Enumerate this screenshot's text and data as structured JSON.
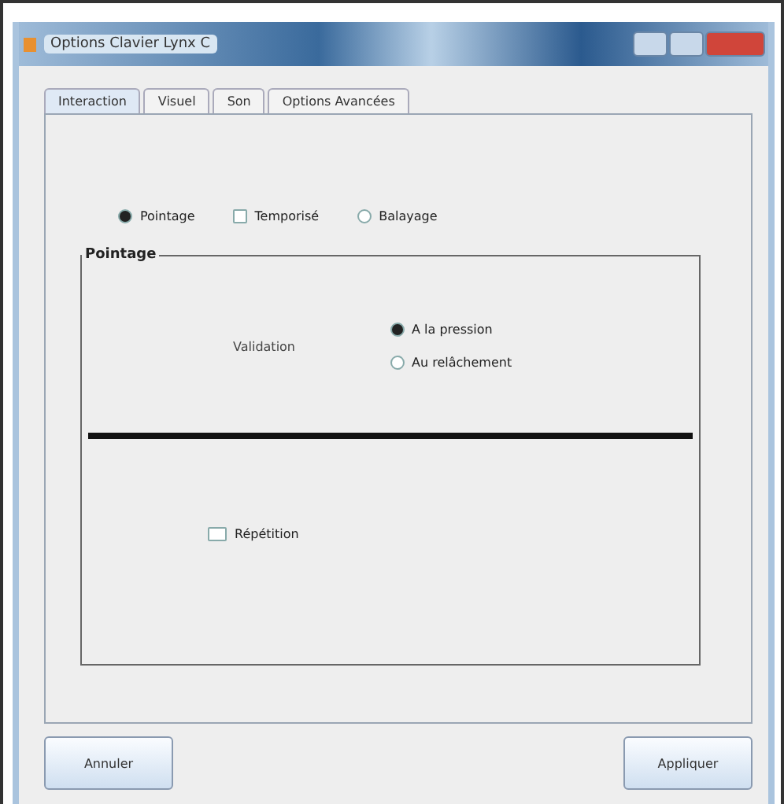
{
  "window": {
    "title": "Options Clavier Lynx C"
  },
  "tabs": [
    {
      "label": "Interaction",
      "selected": true
    },
    {
      "label": "Visuel",
      "selected": false
    },
    {
      "label": "Son",
      "selected": false
    },
    {
      "label": "Options Avancées",
      "selected": false
    }
  ],
  "modes": [
    {
      "label": "Pointage",
      "selected": true
    },
    {
      "label": "Temporisé",
      "selected": false
    },
    {
      "label": "Balayage",
      "selected": false
    }
  ],
  "group": {
    "title": "Pointage",
    "validation_label": "Validation",
    "validation_options": [
      {
        "label": "A la pression",
        "selected": true
      },
      {
        "label": "Au relâchement",
        "selected": false
      }
    ],
    "repetition": {
      "label": "Répétition",
      "checked": false
    }
  },
  "buttons": [
    "Annuler",
    "Appliquer"
  ]
}
